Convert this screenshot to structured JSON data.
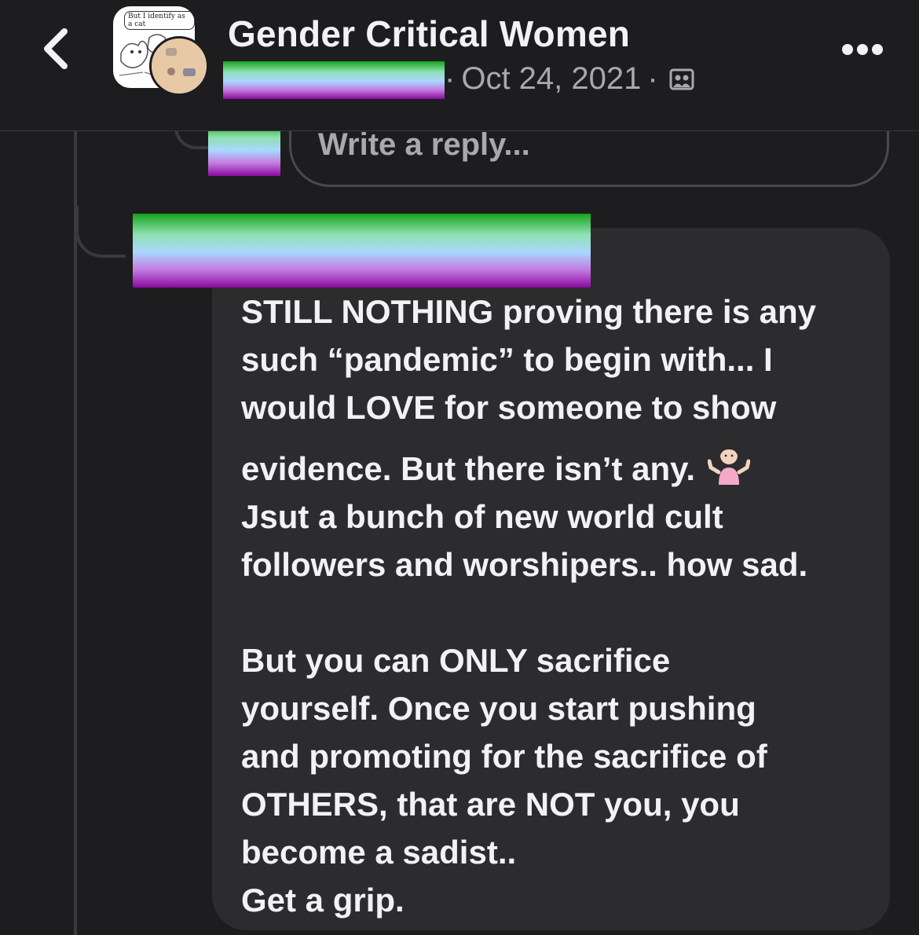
{
  "header": {
    "back_icon": "chevron-left-icon",
    "group_avatar_caption": "But I identify as a cat",
    "group_name": "Gender Critical Women",
    "meta_separator_1": "·",
    "date": "Oct 24, 2021",
    "meta_separator_2": "·",
    "privacy_icon": "group-members-icon",
    "more_icon": "more-horizontal-icon"
  },
  "reply": {
    "placeholder": "Write a reply..."
  },
  "comment": {
    "lines": [
      "STILL NOTHING proving there is any",
      "such “pandemic” to begin with... I",
      "would LOVE for someone to show",
      "evidence. But there isn’t any.",
      "Jsut a bunch of new world cult",
      "followers and worshipers.. how sad.",
      "",
      "But you can ONLY sacrifice",
      "yourself. Once you start pushing",
      "and promoting for the sacrifice of",
      "OTHERS, that are NOT you, you",
      "become a sadist..",
      "Get a grip."
    ],
    "emoji_icon": "woman-shrugging-emoji-icon"
  },
  "colors": {
    "background": "#1d1d1f",
    "bubble": "#2c2c2e",
    "text": "#f2f2f4",
    "muted": "#a8a8ad"
  }
}
